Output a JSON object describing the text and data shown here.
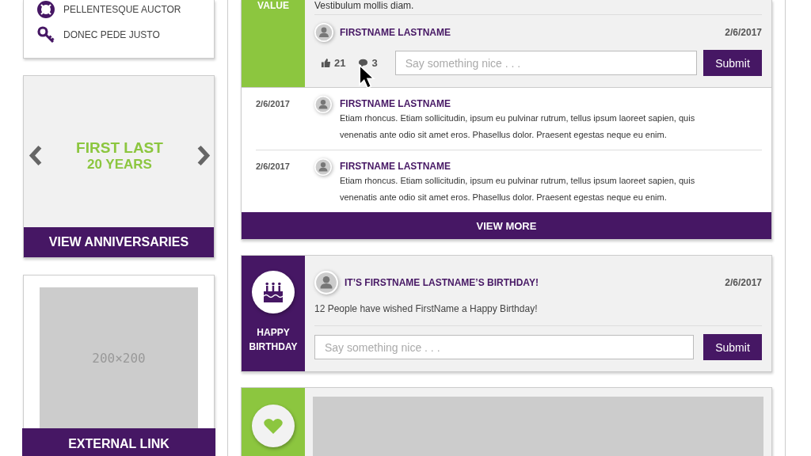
{
  "sidebar": {
    "links": [
      {
        "label": "PELLENTESQUE AUCTOR",
        "kind": "lifebuoy"
      },
      {
        "label": "DONEC PEDE JUSTO",
        "kind": "key"
      }
    ]
  },
  "anniversary": {
    "name": "FIRST LAST",
    "years": "20 YEARS",
    "button": "VIEW ANNIVERSARIES"
  },
  "external": {
    "placeholder_label": "200×200",
    "button": "EXTERNAL LINK"
  },
  "feed": [
    {
      "kind": "post",
      "tag": "VALUE",
      "color": "#8cc63f",
      "text": "Vestibulum mollis diam.",
      "author": "FIRSTNAME LASTNAME",
      "date": "2/6/2017",
      "likes": "21",
      "comment_count": "3",
      "comment_placeholder": "Say something nice . . .",
      "submit": "Submit",
      "comments": [
        {
          "date": "2/6/2017",
          "author": "FIRSTNAME LASTNAME",
          "text": "Etiam rhoncus. Etiam sollicitudin, ipsum eu pulvinar rutrum, tellus ipsum laoreet sapien, quis venenatis ante odio sit amet eros. Phasellus dolor. Praesent egestas neque eu enim."
        },
        {
          "date": "2/6/2017",
          "author": "FIRSTNAME LASTNAME",
          "text": "Etiam rhoncus. Etiam sollicitudin, ipsum eu pulvinar rutrum, tellus ipsum laoreet sapien, quis venenatis ante odio sit amet eros. Phasellus dolor. Praesent egestas neque eu enim."
        }
      ],
      "more": "VIEW MORE"
    },
    {
      "kind": "birthday",
      "tag": "HAPPY BIRTHDAY",
      "color": "#461764",
      "title": "IT’S FIRSTNAME LASTNAME’S BIRTHDAY!",
      "date": "2/6/2017",
      "text": "12 People have wished FirstName a Happy Birthday!",
      "comment_placeholder": "Say something nice . . .",
      "submit": "Submit"
    },
    {
      "kind": "image",
      "color": "#8cc63f"
    }
  ]
}
